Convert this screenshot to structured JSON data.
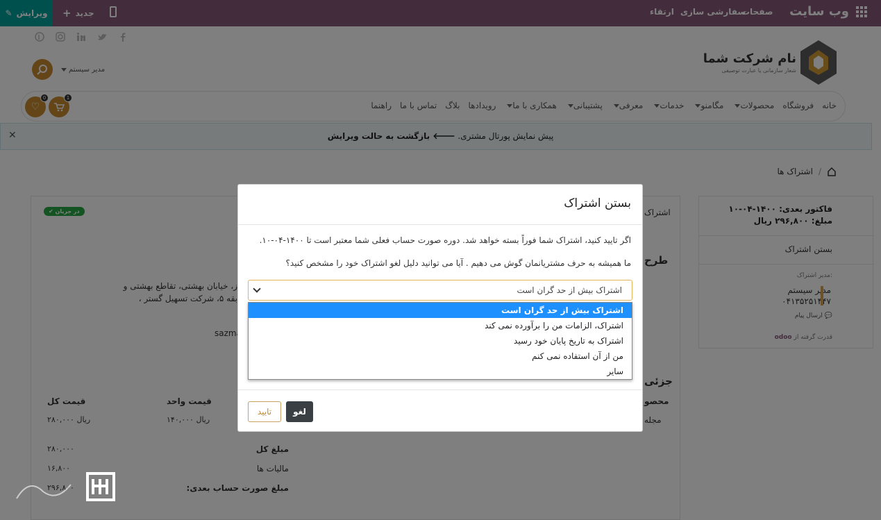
{
  "topbar": {
    "edit_label": "ویرایش",
    "new_label": "جدید",
    "brand": "وب سایت",
    "menu": [
      "صفحات",
      "سفارشی سازی",
      "ارتقاء"
    ]
  },
  "header": {
    "company_name": "نام شرکت شما",
    "slogan": "شعار سازمانی یا عبارت توصیفی",
    "user_name": "مدیر سیستم",
    "cart_count": "1",
    "wishlist_count": "0"
  },
  "nav": {
    "items": [
      {
        "label": "خانه",
        "dropdown": false
      },
      {
        "label": "فروشگاه",
        "dropdown": false
      },
      {
        "label": "محصولات",
        "dropdown": true
      },
      {
        "label": "مگامنو",
        "dropdown": true
      },
      {
        "label": "خدمات",
        "dropdown": true
      },
      {
        "label": "معرفی",
        "dropdown": true
      },
      {
        "label": "پشتیبانی",
        "dropdown": true
      },
      {
        "label": "همکاری با ما",
        "dropdown": true
      },
      {
        "label": "رویدادها",
        "dropdown": false
      },
      {
        "label": "بلاگ",
        "dropdown": false
      },
      {
        "label": "تماس با ما",
        "dropdown": false
      },
      {
        "label": "راهنما",
        "dropdown": false
      }
    ]
  },
  "preview": {
    "text": "پیش نمایش پورتال مشتری.",
    "back_link": "بازگشت به حالت ویرایش"
  },
  "breadcrumb": {
    "current": "اشتراک ها"
  },
  "sidebar": {
    "next_invoice": "فاکتور بعدی: ۱۴۰۰-۰۴-۱۰",
    "amount": "مبلغ: ۲۹۶,۸۰۰ ریال",
    "close_link": "بستن اشتراک",
    "manager_label": "مدیر اشتراک:",
    "manager_name": "مدیر سیستم",
    "manager_phone": "۰۴۱۳۵۲۵۱۴۴۷",
    "send_message": "ارسال پیام",
    "powered_by": "قدرت گرفته از",
    "odoo": "odoo"
  },
  "background": {
    "status": "در جریان",
    "tab_label": "اشتراک",
    "plan_heading": "طرح",
    "address_line1": "ز، خیابان بهشتی، تقاطع بهشتی و",
    "address_line2": "بقه ۵، شرکت تسهیل گستر ،",
    "email_partial": "sazma",
    "details_heading": "جزئی",
    "product_label": "محصو",
    "product_value": "مجله",
    "col_total": "قیمت کل",
    "col_unit": "قیمت واحد",
    "row_total": "۲۸۰,۰۰۰ ریال",
    "row_unit": "۱۴۰,۰۰۰ ریال",
    "total_label": "مبلغ کل",
    "total_value": "۲۸۰,۰۰۰",
    "tax_label": "مالیات ها",
    "tax_value": "۱۶,۸۰۰",
    "next_bill_label": "مبلغ صورت حساب بعدی:",
    "next_bill_value": "۲۹۶,۸۰۰"
  },
  "modal": {
    "title": "بستن اشتراک",
    "message": "اگر تایید کنید، اشتراک شما فوراً بسته خواهد شد. دوره صورت حساب فعلی شما معتبر است تا ۱۴۰۰-۰۴-۱۰.",
    "question": "ما همیشه به حرف مشتریانمان گوش می دهیم . آیا می توانید دلیل لغو اشتراک خود را مشخص کنید؟",
    "selected": "اشتراک بیش از حد گران است",
    "options": [
      "اشتراک بیش از حد گران است",
      "اشتراک، الزامات من را برآورده نمی کند",
      "اشتراک به تاریخ پایان خود رسید",
      "من از آن استفاده نمی کنم",
      "سایر"
    ],
    "cancel_label": "لغو",
    "confirm_label": "تایید"
  },
  "colors": {
    "topbar": "#875a7b",
    "edit": "#00a09d",
    "accent": "#c98a2f",
    "selected_option": "#1e90ff"
  }
}
